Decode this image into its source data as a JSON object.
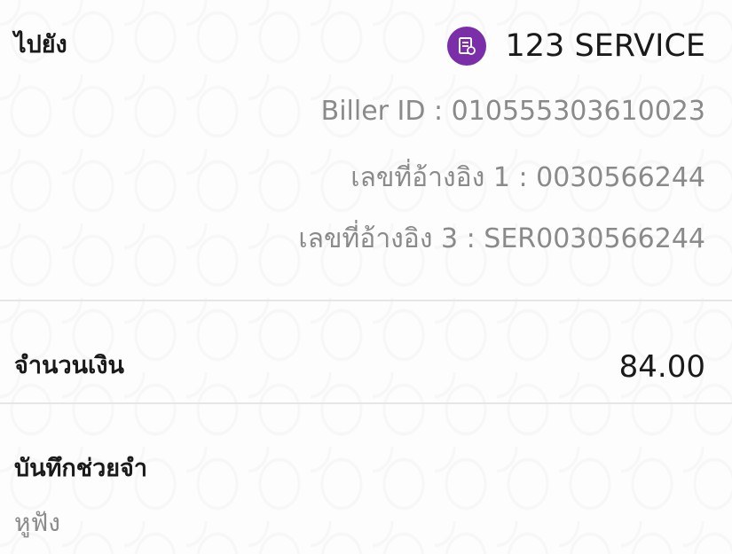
{
  "to": {
    "label": "ไปยัง",
    "merchant_name": "123 SERVICE",
    "merchant_icon": "bill-icon",
    "biller_id": "Biller ID : 010555303610023",
    "reference_1": "เลขที่อ้างอิง 1 : 0030566244",
    "reference_3": "เลขที่อ้างอิง 3 : SER0030566244"
  },
  "amount": {
    "label": "จำนวนเงิน",
    "value": "84.00"
  },
  "note": {
    "label": "บันทึกช่วยจำ",
    "value": "หูฟัง"
  },
  "colors": {
    "accent": "#7a2fa8",
    "secondary_text": "#8a8a8a",
    "divider": "#e6e6e6"
  }
}
